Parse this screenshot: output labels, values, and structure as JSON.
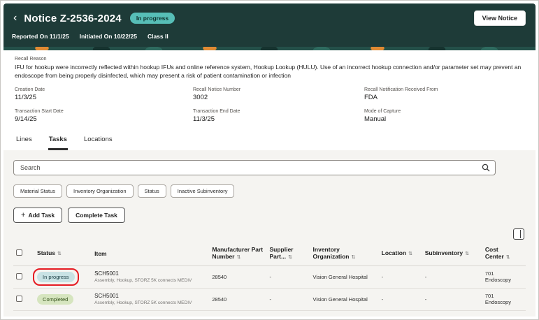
{
  "header": {
    "title": "Notice Z-2536-2024",
    "status_badge": "In progress",
    "view_notice_button": "View Notice",
    "meta": {
      "reported_on": "Reported On 11/1/25",
      "initiated_on": "Initiated On 10/22/25",
      "class": "Class II"
    }
  },
  "icons": {
    "back": "‹",
    "plus": "+",
    "sort": "⇅"
  },
  "recall": {
    "reason_label": "Recall Reason",
    "reason_text": "IFU for hookup were incorrectly reflected within hookup IFUs and online reference system, Hookup Lookup (HULU). Use of an incorrect hookup connection and/or parameter set may prevent an endoscope from being properly disinfected, which may present a risk of patient contamination or infection",
    "fields": [
      {
        "label": "Creation Date",
        "value": "11/3/25"
      },
      {
        "label": "Recall Notice Number",
        "value": "3002"
      },
      {
        "label": "Recall Notification Received From",
        "value": "FDA"
      },
      {
        "label": "Transaction Start Date",
        "value": "9/14/25"
      },
      {
        "label": "Transaction End Date",
        "value": "11/3/25"
      },
      {
        "label": "Mode of Capture",
        "value": "Manual"
      }
    ]
  },
  "tabs": [
    {
      "label": "Lines",
      "active": false
    },
    {
      "label": "Tasks",
      "active": true
    },
    {
      "label": "Locations",
      "active": false
    }
  ],
  "tasks": {
    "search_placeholder": "Search",
    "chips": [
      "Material Status",
      "Inventory Organization",
      "Status",
      "Inactive Subinventory"
    ],
    "add_task_button": "Add Task",
    "complete_task_button": "Complete Task",
    "table": {
      "columns": [
        "Status",
        "Item",
        "Manufacturer Part Number",
        "Supplier Part...",
        "Inventory Organization",
        "Location",
        "Subinventory",
        "Cost Center"
      ],
      "rows": [
        {
          "status": "In progress",
          "item_code": "SCH5001",
          "item_desc": "Assembly, Hookup, STORZ 5K connects MEDIV",
          "manufacturer_part_number": "28540",
          "supplier_part": "-",
          "inventory_organization": "Vision General Hospital",
          "location": "-",
          "subinventory": "-",
          "cost_center": "701",
          "cost_center_dept": "Endoscopy",
          "annotated": true
        },
        {
          "status": "Completed",
          "item_code": "SCH5001",
          "item_desc": "Assembly, Hookup, STORZ 5K connects MEDIV",
          "manufacturer_part_number": "28540",
          "supplier_part": "-",
          "inventory_organization": "Vision General Hospital",
          "location": "-",
          "subinventory": "-",
          "cost_center": "701",
          "cost_center_dept": "Endoscopy",
          "annotated": false
        }
      ]
    }
  },
  "colors": {
    "header_bg": "#1e3b38",
    "header_badge_bg": "#57beb7",
    "in_progress_pill_bg": "#c8e2e4",
    "completed_pill_bg": "#d6e5bf",
    "annotation_red": "#e51b22",
    "panel_bg": "#f5f4f1"
  }
}
